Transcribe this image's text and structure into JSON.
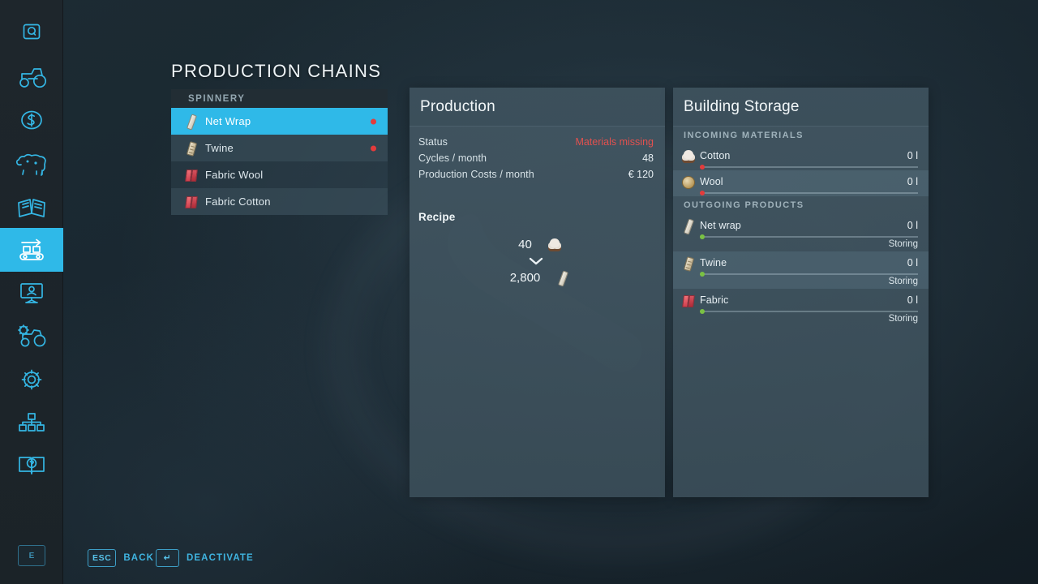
{
  "page_title": "PRODUCTION CHAINS",
  "colors": {
    "accent": "#2fb9e8",
    "alert": "#e2514f",
    "ok": "#7ac143",
    "panel": "#3a4b55"
  },
  "sidebar": {
    "items": [
      {
        "icon": "quest-q-icon",
        "label": "Quests",
        "active": false
      },
      {
        "icon": "tractor-icon",
        "label": "Vehicles",
        "active": false
      },
      {
        "icon": "dollar-coin-icon",
        "label": "Finances",
        "active": false
      },
      {
        "icon": "cow-icon",
        "label": "Animals",
        "active": false
      },
      {
        "icon": "open-book-icon",
        "label": "Price Overview",
        "active": false
      },
      {
        "icon": "conveyor-belt-icon",
        "label": "Production Chains",
        "active": true
      },
      {
        "icon": "monitor-person-icon",
        "label": "Contracts",
        "active": false
      },
      {
        "icon": "tractor-gear-icon",
        "label": "Vehicle Config",
        "active": false
      },
      {
        "icon": "gear-icon",
        "label": "Settings",
        "active": false
      },
      {
        "icon": "sitemap-icon",
        "label": "Statistics",
        "active": false
      },
      {
        "icon": "book-help-icon",
        "label": "Help",
        "active": false
      }
    ],
    "bottom_key": "E"
  },
  "production_list": {
    "group_label": "SPINNERY",
    "rows": [
      {
        "label": "Net Wrap",
        "icon": "net-wrap-roll-icon",
        "selected": true,
        "status_dot": "red"
      },
      {
        "label": "Twine",
        "icon": "twine-roll-icon",
        "selected": false,
        "status_dot": "red"
      },
      {
        "label": "Fabric Wool",
        "icon": "fabric-bolt-icon",
        "selected": false,
        "status_dot": null
      },
      {
        "label": "Fabric Cotton",
        "icon": "fabric-bolt-icon",
        "selected": false,
        "status_dot": null
      }
    ]
  },
  "production": {
    "title": "Production",
    "stats": [
      {
        "key": "Status",
        "value": "Materials missing",
        "alert": true
      },
      {
        "key": "Cycles / month",
        "value": "48",
        "alert": false
      },
      {
        "key": "Production Costs / month",
        "value": "€ 120",
        "alert": false
      }
    ],
    "recipe_label": "Recipe",
    "recipe": {
      "input": {
        "amount": "40",
        "icon": "cotton-icon"
      },
      "output": {
        "amount": "2,800",
        "icon": "net-wrap-roll-icon"
      }
    }
  },
  "storage": {
    "title": "Building Storage",
    "incoming_label": "INCOMING MATERIALS",
    "outgoing_label": "OUTGOING PRODUCTS",
    "incoming": [
      {
        "name": "Cotton",
        "icon": "cotton-icon",
        "amount": "0 l",
        "fill_pct": 0,
        "dot": "red",
        "state": null
      },
      {
        "name": "Wool",
        "icon": "wool-icon",
        "amount": "0 l",
        "fill_pct": 0,
        "dot": "red",
        "state": null
      }
    ],
    "outgoing": [
      {
        "name": "Net wrap",
        "icon": "net-wrap-roll-icon",
        "amount": "0 l",
        "fill_pct": 0,
        "dot": "green",
        "state": "Storing"
      },
      {
        "name": "Twine",
        "icon": "twine-roll-icon",
        "amount": "0 l",
        "fill_pct": 0,
        "dot": "green",
        "state": "Storing"
      },
      {
        "name": "Fabric",
        "icon": "fabric-bolt-icon",
        "amount": "0 l",
        "fill_pct": 0,
        "dot": "green",
        "state": "Storing"
      }
    ]
  },
  "footer": {
    "hotkeys": [
      {
        "key": "ESC",
        "label": "BACK"
      },
      {
        "key": "↵",
        "label": "DEACTIVATE"
      }
    ]
  }
}
